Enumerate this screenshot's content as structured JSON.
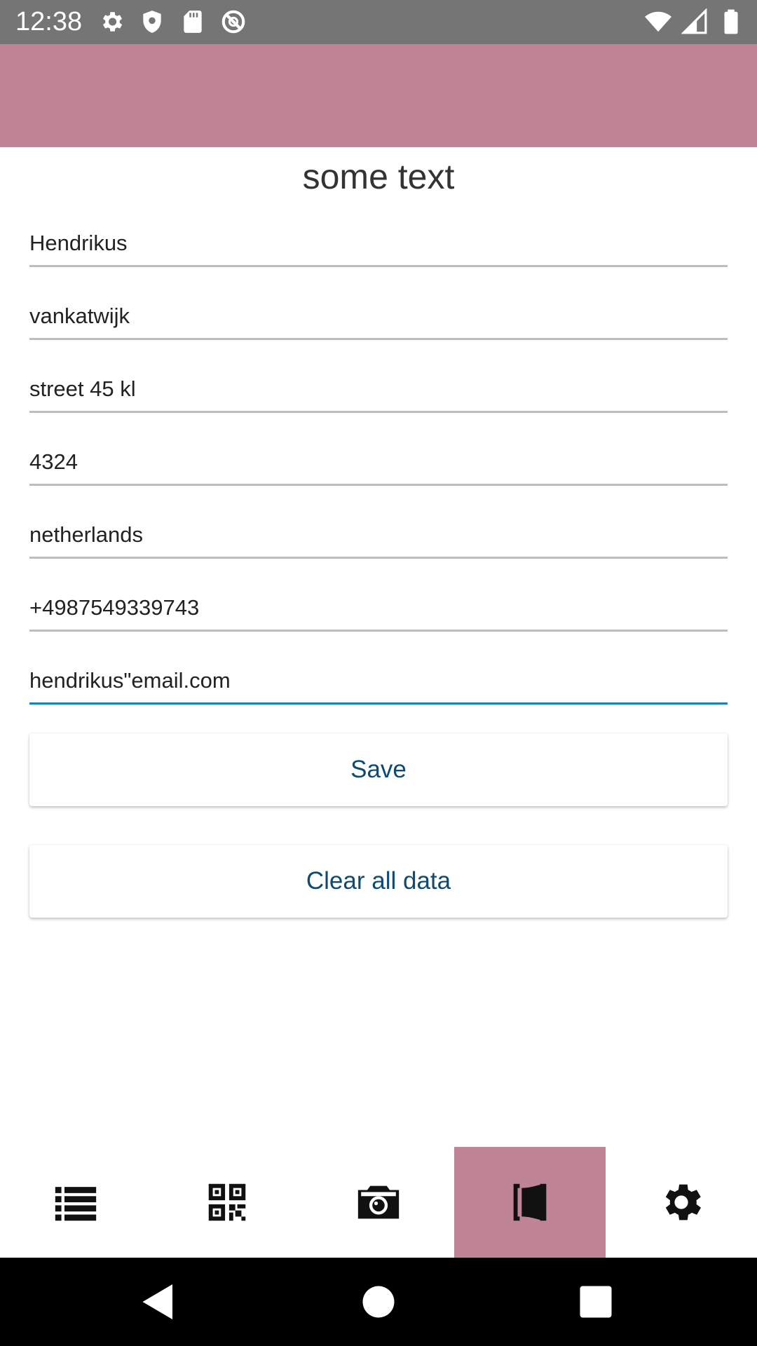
{
  "status_bar": {
    "time": "12:38",
    "left_icons": [
      "gear-icon",
      "shield-icon",
      "sd-card-icon",
      "at-sign-icon"
    ],
    "right_icons": [
      "wifi-icon",
      "signal-icon",
      "battery-icon"
    ]
  },
  "page": {
    "title": "some text"
  },
  "form": {
    "fields": [
      {
        "value": "Hendrikus"
      },
      {
        "value": "vankatwijk"
      },
      {
        "value": "street 45 kl"
      },
      {
        "value": "4324"
      },
      {
        "value": "netherlands"
      },
      {
        "value": "+4987549339743"
      },
      {
        "value": "hendrikus\"email.com",
        "focused": true
      }
    ],
    "save_label": "Save",
    "clear_label": "Clear all data"
  },
  "tabs": [
    {
      "icon": "list-icon",
      "active": false
    },
    {
      "icon": "qr-code-icon",
      "active": false
    },
    {
      "icon": "camera-icon",
      "active": false
    },
    {
      "icon": "contact-card-icon",
      "active": true
    },
    {
      "icon": "gear-icon",
      "active": false
    }
  ],
  "colors": {
    "accent": "#bf8495",
    "status_bar": "#757575",
    "button_text": "#0e4a72",
    "focus_line": "#1f7fb8"
  }
}
